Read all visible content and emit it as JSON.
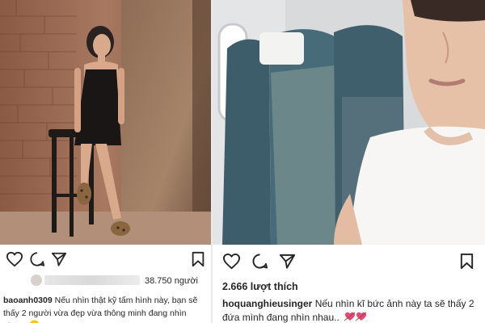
{
  "left_post": {
    "username": "baoanh0309",
    "likes_count": "38.750",
    "likes_suffix": "người",
    "caption": "Nếu nhìn thật kỹ tấm hình này, bạn sẽ thấy 2 người vừa đẹp vừa thông minh đang nhìn nhau!",
    "icons": [
      "heart-icon",
      "comment-icon",
      "share-icon",
      "bookmark-icon"
    ]
  },
  "right_post": {
    "likes_text": "2.666 lượt thích",
    "username": "hoquanghieusinger",
    "caption": "Nếu nhìn kĩ bức ảnh này ta sẽ thấy 2 đứa mình đang nhìn nhau..",
    "icons": [
      "heart-icon",
      "comment-icon",
      "share-icon",
      "bookmark-icon"
    ]
  },
  "colors": {
    "text": "#262626",
    "divider": "#e9e9e9",
    "accent_heart": "#e8457a",
    "emoji_face": "#f5c518"
  }
}
